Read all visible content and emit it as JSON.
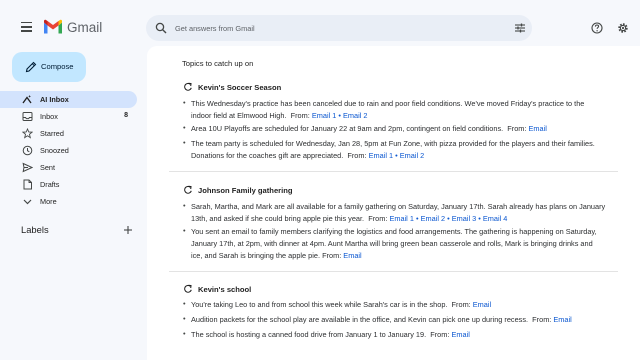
{
  "app": {
    "brand": "Gmail"
  },
  "search": {
    "placeholder": "Get answers from Gmail"
  },
  "compose": {
    "label": "Compose"
  },
  "nav": [
    {
      "label": "AI Inbox",
      "icon": "ai-inbox-icon",
      "active": true,
      "count": ""
    },
    {
      "label": "Inbox",
      "icon": "inbox-icon",
      "active": false,
      "count": "8"
    },
    {
      "label": "Starred",
      "icon": "star-icon",
      "active": false,
      "count": ""
    },
    {
      "label": "Snoozed",
      "icon": "clock-icon",
      "active": false,
      "count": ""
    },
    {
      "label": "Sent",
      "icon": "send-icon",
      "active": false,
      "count": ""
    },
    {
      "label": "Drafts",
      "icon": "draft-icon",
      "active": false,
      "count": ""
    },
    {
      "label": "More",
      "icon": "chevron-down-icon",
      "active": false,
      "count": ""
    }
  ],
  "labels": {
    "heading": "Labels"
  },
  "main": {
    "topics_title": "Topics to catch up on",
    "sections": [
      {
        "title": "Kevin's Soccer Season",
        "bullets": [
          {
            "lines": [
              "This Wednesday's practice has been canceled due to rain and poor field conditions. We've moved Friday's practice to the",
              "indoor field at Elmwood High."
            ],
            "from": "From:",
            "links": [
              "Email 1",
              "Email 2"
            ]
          },
          {
            "lines": [
              "Area 10U Playoffs are scheduled for January 22 at 9am and 2pm, contingent on field conditions."
            ],
            "from": "From:",
            "links": [
              "Email"
            ]
          },
          {
            "lines": [
              "The team party is scheduled for Wednesday, Jan 28, 5pm at Fun Zone, with pizza provided for the players and their families.",
              "Donations for the coaches gift are appreciated."
            ],
            "from": "From:",
            "links": [
              "Email 1",
              "Email 2"
            ]
          }
        ]
      },
      {
        "title": "Johnson Family gathering",
        "bullets": [
          {
            "lines": [
              "Sarah, Martha, and Mark are all available for a family gathering on Saturday, January 17th. Sarah already has plans on January",
              "13th, and asked if she could bring apple pie this year."
            ],
            "from": "From:",
            "links": [
              "Email 1",
              "Email 2",
              "Email 3",
              "Email 4"
            ]
          },
          {
            "lines": [
              "You sent an email to family members clarifying the logistics and food arrangements. The gathering is happening on Saturday,",
              "January 17th, at 2pm, with dinner at 4pm. Aunt Martha will bring green bean casserole and rolls, Mark is bringing drinks and",
              "ice, and Sarah is bringing the apple pie."
            ],
            "from": "From:",
            "links": [
              "Email"
            ]
          }
        ]
      },
      {
        "title": "Kevin's school",
        "bullets": [
          {
            "lines": [
              "You're taking Leo to and from school this week while Sarah's car is in the shop."
            ],
            "from": "From:",
            "links": [
              "Email"
            ]
          },
          {
            "lines": [
              "Audition packets for the school play are available in the office, and Kevin can pick one up during recess."
            ],
            "from": "From:",
            "links": [
              "Email"
            ]
          },
          {
            "lines": [
              "The school is hosting a canned food drive from January 1 to January 19."
            ],
            "from": "From:",
            "links": [
              "Email"
            ]
          }
        ]
      }
    ]
  },
  "colors": {
    "accent": "#0b57d0",
    "compose_bg": "#c2e7ff",
    "active_nav": "#d3e3fd",
    "page_bg": "#f6f8fc"
  }
}
